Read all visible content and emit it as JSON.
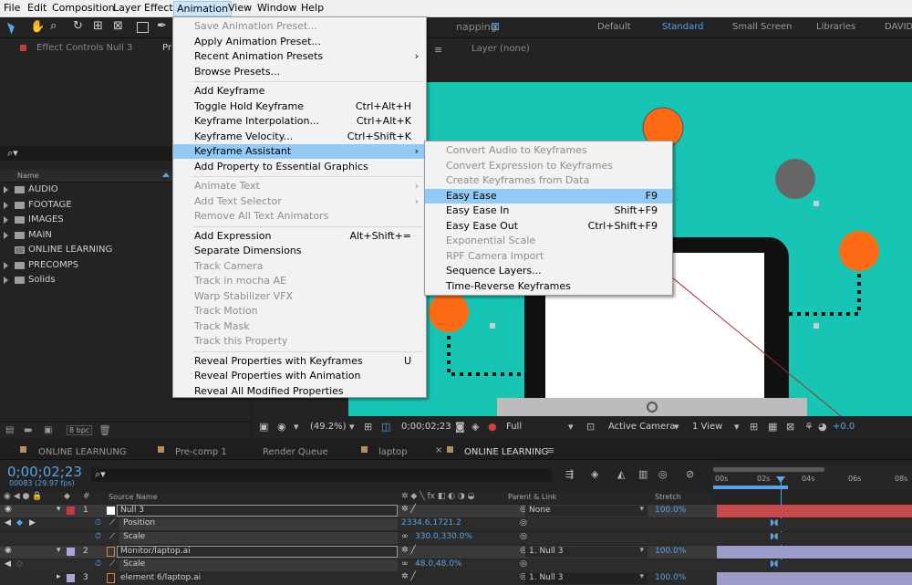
{
  "menubar": {
    "items": [
      "File",
      "Edit",
      "Composition",
      "Layer",
      "Effect",
      "Animation",
      "View",
      "Window",
      "Help"
    ],
    "active": "Animation"
  },
  "workspace": {
    "snapping": "napping",
    "items": [
      "Default",
      "Standard",
      "Small Screen",
      "Libraries",
      "DAVID"
    ],
    "active": "Standard"
  },
  "effect_controls": {
    "tab": "Effect Controls Null 3",
    "pre": "Pr"
  },
  "layer_tab": "Layer (none)",
  "project": {
    "search_icon": "search-icon",
    "col_name": "Name",
    "items": [
      {
        "name": "AUDIO",
        "type": "folder"
      },
      {
        "name": "FOOTAGE",
        "type": "folder"
      },
      {
        "name": "IMAGES",
        "type": "folder"
      },
      {
        "name": "MAIN",
        "type": "folder"
      },
      {
        "name": "ONLINE LEARNING",
        "type": "comp"
      },
      {
        "name": "PRECOMPS",
        "type": "folder"
      },
      {
        "name": "Solids",
        "type": "folder"
      }
    ],
    "bpc": "8 bpc"
  },
  "animation_menu": {
    "items": [
      {
        "label": "Save Animation Preset...",
        "disabled": true
      },
      {
        "label": "Apply Animation Preset..."
      },
      {
        "label": "Recent Animation Presets",
        "arrow": true
      },
      {
        "label": "Browse Presets..."
      },
      {
        "sep": true
      },
      {
        "label": "Add Keyframe"
      },
      {
        "label": "Toggle Hold Keyframe",
        "shortcut": "Ctrl+Alt+H"
      },
      {
        "label": "Keyframe Interpolation...",
        "shortcut": "Ctrl+Alt+K"
      },
      {
        "label": "Keyframe Velocity...",
        "shortcut": "Ctrl+Shift+K"
      },
      {
        "label": "Keyframe Assistant",
        "arrow": true,
        "highlight": true
      },
      {
        "label": "Add Property to Essential Graphics"
      },
      {
        "sep": true
      },
      {
        "label": "Animate Text",
        "arrow": true,
        "disabled": true
      },
      {
        "label": "Add Text Selector",
        "arrow": true,
        "disabled": true
      },
      {
        "label": "Remove All Text Animators",
        "disabled": true
      },
      {
        "sep": true
      },
      {
        "label": "Add Expression",
        "shortcut": "Alt+Shift+="
      },
      {
        "label": "Separate Dimensions"
      },
      {
        "label": "Track Camera",
        "disabled": true
      },
      {
        "label": "Track in mocha AE",
        "disabled": true
      },
      {
        "label": "Warp Stabilizer VFX",
        "disabled": true
      },
      {
        "label": "Track Motion",
        "disabled": true
      },
      {
        "label": "Track Mask",
        "disabled": true
      },
      {
        "label": "Track this Property",
        "disabled": true
      },
      {
        "sep": true
      },
      {
        "label": "Reveal Properties with Keyframes",
        "shortcut": "U"
      },
      {
        "label": "Reveal Properties with Animation"
      },
      {
        "label": "Reveal All Modified Properties"
      }
    ]
  },
  "assistant_menu": {
    "items": [
      {
        "label": "Convert Audio to Keyframes",
        "disabled": true
      },
      {
        "label": "Convert Expression to Keyframes",
        "disabled": true
      },
      {
        "label": "Create Keyframes from Data",
        "disabled": true
      },
      {
        "label": "Easy Ease",
        "shortcut": "F9",
        "highlight": true
      },
      {
        "label": "Easy Ease In",
        "shortcut": "Shift+F9"
      },
      {
        "label": "Easy Ease Out",
        "shortcut": "Ctrl+Shift+F9"
      },
      {
        "label": "Exponential Scale",
        "disabled": true
      },
      {
        "label": "RPF Camera Import",
        "disabled": true
      },
      {
        "label": "Sequence Layers..."
      },
      {
        "label": "Time-Reverse Keyframes"
      }
    ]
  },
  "viewer_bar": {
    "zoom": "(49.2%)",
    "timecode": "0;00;02;23",
    "quality": "Full",
    "camera": "Active Camera",
    "views": "1 View",
    "exposure": "+0.0"
  },
  "timeline": {
    "tabs": [
      "ONLINE LEARNUNG",
      "Pre-comp 1",
      "Render Queue",
      "laptop",
      "ONLINE LEARNING"
    ],
    "active_tab": "ONLINE LEARNING",
    "timecode": "0;00;02;23",
    "fps": "00083 (29.97 fps)",
    "columns": {
      "source": "Source Name",
      "parent": "Parent & Link",
      "stretch": "Stretch"
    },
    "ruler": [
      "00s",
      "02s",
      "04s",
      "06s",
      "08s"
    ],
    "layers": [
      {
        "num": "1",
        "name": "Null 3",
        "parent": "None",
        "stretch": "100.0%",
        "color": "#c33b3b",
        "selected": true
      },
      {
        "prop": "Position",
        "value": "2334.6,1721.2"
      },
      {
        "prop": "Scale",
        "value": "330.0,330.0%"
      },
      {
        "num": "2",
        "name": "Monitor/laptop.ai",
        "parent": "1. Null 3",
        "stretch": "100.0%",
        "color": "#a7a7d8",
        "selected": true
      },
      {
        "prop": "Scale",
        "value": "48.0,48.0%"
      },
      {
        "num": "3",
        "name": "element 6/laptop.ai",
        "parent": "1. Null 3",
        "stretch": "100.0%",
        "color": "#a7a7d8"
      }
    ]
  }
}
